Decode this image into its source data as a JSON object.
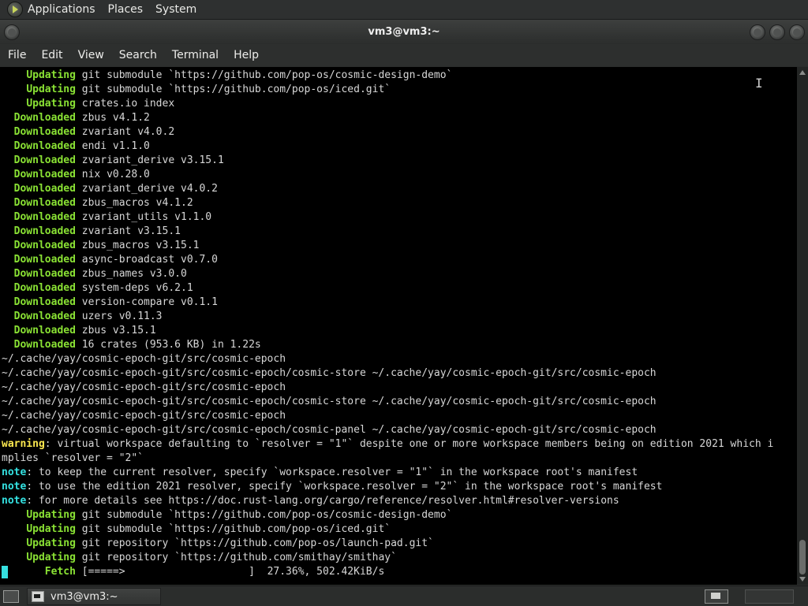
{
  "top_panel": {
    "menus": [
      "Applications",
      "Places",
      "System"
    ]
  },
  "window": {
    "title": "vm3@vm3:~"
  },
  "menubar": {
    "items": [
      "File",
      "Edit",
      "View",
      "Search",
      "Terminal",
      "Help"
    ]
  },
  "terminal": {
    "colors": {
      "green": "#8ae234",
      "yellow": "#fce94f",
      "cyan": "#34e2e2",
      "text": "#d7d7d7",
      "background": "#000000"
    },
    "lines": [
      {
        "pad": "    ",
        "keyword": "Updating",
        "style": "green",
        "text": " git submodule `https://github.com/pop-os/cosmic-design-demo`"
      },
      {
        "pad": "    ",
        "keyword": "Updating",
        "style": "green",
        "text": " git submodule `https://github.com/pop-os/iced.git`"
      },
      {
        "pad": "    ",
        "keyword": "Updating",
        "style": "green",
        "text": " crates.io index"
      },
      {
        "pad": "  ",
        "keyword": "Downloaded",
        "style": "green",
        "text": " zbus v4.1.2"
      },
      {
        "pad": "  ",
        "keyword": "Downloaded",
        "style": "green",
        "text": " zvariant v4.0.2"
      },
      {
        "pad": "  ",
        "keyword": "Downloaded",
        "style": "green",
        "text": " endi v1.1.0"
      },
      {
        "pad": "  ",
        "keyword": "Downloaded",
        "style": "green",
        "text": " zvariant_derive v3.15.1"
      },
      {
        "pad": "  ",
        "keyword": "Downloaded",
        "style": "green",
        "text": " nix v0.28.0"
      },
      {
        "pad": "  ",
        "keyword": "Downloaded",
        "style": "green",
        "text": " zvariant_derive v4.0.2"
      },
      {
        "pad": "  ",
        "keyword": "Downloaded",
        "style": "green",
        "text": " zbus_macros v4.1.2"
      },
      {
        "pad": "  ",
        "keyword": "Downloaded",
        "style": "green",
        "text": " zvariant_utils v1.1.0"
      },
      {
        "pad": "  ",
        "keyword": "Downloaded",
        "style": "green",
        "text": " zvariant v3.15.1"
      },
      {
        "pad": "  ",
        "keyword": "Downloaded",
        "style": "green",
        "text": " zbus_macros v3.15.1"
      },
      {
        "pad": "  ",
        "keyword": "Downloaded",
        "style": "green",
        "text": " async-broadcast v0.7.0"
      },
      {
        "pad": "  ",
        "keyword": "Downloaded",
        "style": "green",
        "text": " zbus_names v3.0.0"
      },
      {
        "pad": "  ",
        "keyword": "Downloaded",
        "style": "green",
        "text": " system-deps v6.2.1"
      },
      {
        "pad": "  ",
        "keyword": "Downloaded",
        "style": "green",
        "text": " version-compare v0.1.1"
      },
      {
        "pad": "  ",
        "keyword": "Downloaded",
        "style": "green",
        "text": " uzers v0.11.3"
      },
      {
        "pad": "  ",
        "keyword": "Downloaded",
        "style": "green",
        "text": " zbus v3.15.1"
      },
      {
        "pad": "  ",
        "keyword": "Downloaded",
        "style": "green",
        "text": " 16 crates (953.6 KB) in 1.22s"
      },
      {
        "pad": "",
        "keyword": "",
        "style": "",
        "text": "~/.cache/yay/cosmic-epoch-git/src/cosmic-epoch"
      },
      {
        "pad": "",
        "keyword": "",
        "style": "",
        "text": "~/.cache/yay/cosmic-epoch-git/src/cosmic-epoch/cosmic-store ~/.cache/yay/cosmic-epoch-git/src/cosmic-epoch"
      },
      {
        "pad": "",
        "keyword": "",
        "style": "",
        "text": "~/.cache/yay/cosmic-epoch-git/src/cosmic-epoch"
      },
      {
        "pad": "",
        "keyword": "",
        "style": "",
        "text": "~/.cache/yay/cosmic-epoch-git/src/cosmic-epoch/cosmic-store ~/.cache/yay/cosmic-epoch-git/src/cosmic-epoch"
      },
      {
        "pad": "",
        "keyword": "",
        "style": "",
        "text": "~/.cache/yay/cosmic-epoch-git/src/cosmic-epoch"
      },
      {
        "pad": "",
        "keyword": "",
        "style": "",
        "text": "~/.cache/yay/cosmic-epoch-git/src/cosmic-epoch/cosmic-panel ~/.cache/yay/cosmic-epoch-git/src/cosmic-epoch"
      },
      {
        "pad": "",
        "keyword": "warning",
        "style": "yellow",
        "text": ": virtual workspace defaulting to `resolver = \"1\"` despite one or more workspace members being on edition 2021 which i"
      },
      {
        "pad": "",
        "keyword": "",
        "style": "",
        "text": "mplies `resolver = \"2\"`"
      },
      {
        "pad": "",
        "keyword": "note",
        "style": "cyan",
        "text": ": to keep the current resolver, specify `workspace.resolver = \"1\"` in the workspace root's manifest"
      },
      {
        "pad": "",
        "keyword": "note",
        "style": "cyan",
        "text": ": to use the edition 2021 resolver, specify `workspace.resolver = \"2\"` in the workspace root's manifest"
      },
      {
        "pad": "",
        "keyword": "note",
        "style": "cyan",
        "text": ": for more details see https://doc.rust-lang.org/cargo/reference/resolver.html#resolver-versions"
      },
      {
        "pad": "    ",
        "keyword": "Updating",
        "style": "green",
        "text": " git submodule `https://github.com/pop-os/cosmic-design-demo`"
      },
      {
        "pad": "    ",
        "keyword": "Updating",
        "style": "green",
        "text": " git submodule `https://github.com/pop-os/iced.git`"
      },
      {
        "pad": "    ",
        "keyword": "Updating",
        "style": "green",
        "text": " git repository `https://github.com/pop-os/launch-pad.git`"
      },
      {
        "pad": "    ",
        "keyword": "Updating",
        "style": "green",
        "text": " git repository `https://github.com/smithay/smithay`"
      },
      {
        "pad": "       ",
        "keyword": "Fetch",
        "style": "green",
        "text": " [=====>                    ]  27.36%, 502.42KiB/s"
      }
    ]
  },
  "taskbar": {
    "task_label": "vm3@vm3:~"
  }
}
